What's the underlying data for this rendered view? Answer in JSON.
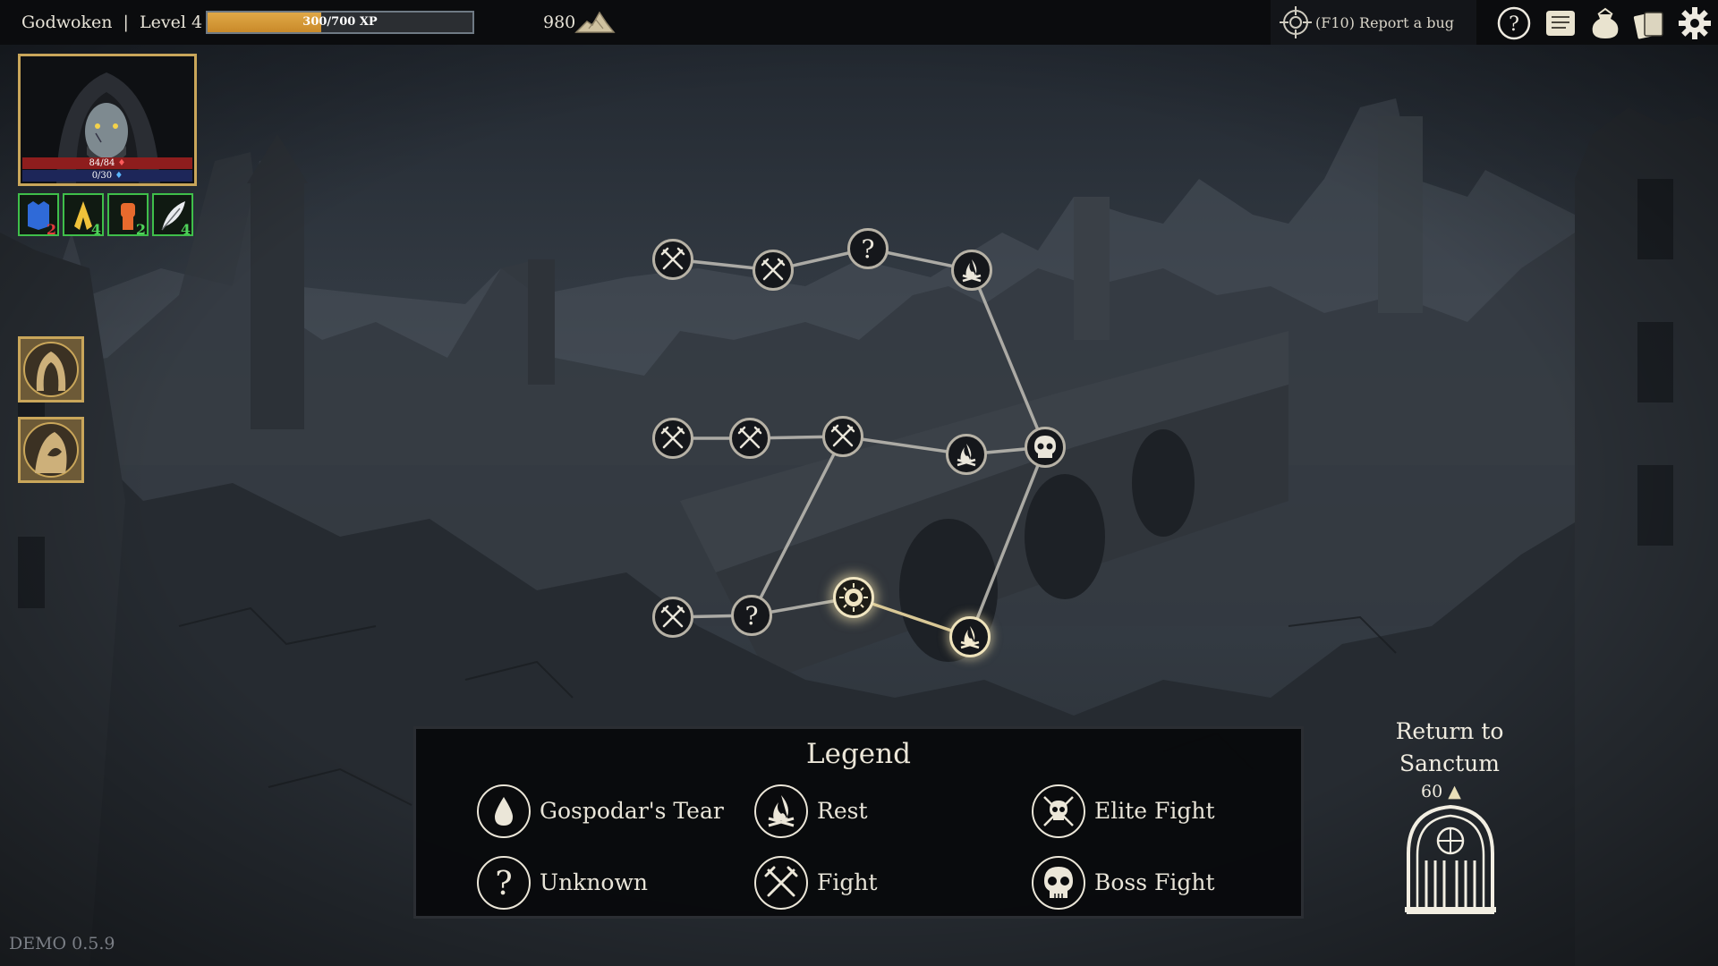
{
  "topbar": {
    "player_name": "Godwoken",
    "separator": "|",
    "level": "Level 4",
    "xp_text": "300/700 XP",
    "xp_fraction": 0.43,
    "gold": "980",
    "bug_report": "(F10) Report a bug",
    "icons": [
      "help-icon",
      "scroll-icon",
      "pouch-icon",
      "cards-icon",
      "gear-icon"
    ]
  },
  "character": {
    "hp": "84/84",
    "mana": "0/30",
    "buffs": [
      {
        "icon": "armor-icon",
        "count": "2",
        "color": "#e23b3b"
      },
      {
        "icon": "prayer-icon",
        "count": "4",
        "color": "#4fd15a"
      },
      {
        "icon": "fist-icon",
        "count": "2",
        "color": "#4fd15a"
      },
      {
        "icon": "feather-icon",
        "count": "4",
        "color": "#4fd15a"
      }
    ],
    "companions": [
      "hooded-companion-1",
      "hooded-companion-2"
    ]
  },
  "map": {
    "nodes": [
      {
        "id": "n1",
        "type": "fight"
      },
      {
        "id": "n2",
        "type": "fight"
      },
      {
        "id": "n3",
        "type": "unknown"
      },
      {
        "id": "n4",
        "type": "rest"
      },
      {
        "id": "n5",
        "type": "fight"
      },
      {
        "id": "n6",
        "type": "fight"
      },
      {
        "id": "n7",
        "type": "fight"
      },
      {
        "id": "n8",
        "type": "rest"
      },
      {
        "id": "n9",
        "type": "boss"
      },
      {
        "id": "n10",
        "type": "fight"
      },
      {
        "id": "n11",
        "type": "unknown"
      },
      {
        "id": "n12",
        "type": "current"
      },
      {
        "id": "n13",
        "type": "rest",
        "state": "available"
      }
    ]
  },
  "legend": {
    "title": "Legend",
    "items": [
      {
        "icon": "tear",
        "label": "Gospodar's Tear"
      },
      {
        "icon": "rest",
        "label": "Rest"
      },
      {
        "icon": "elite",
        "label": "Elite Fight"
      },
      {
        "icon": "unknown",
        "label": "Unknown"
      },
      {
        "icon": "fight",
        "label": "Fight"
      },
      {
        "icon": "boss",
        "label": "Boss Fight"
      }
    ]
  },
  "sanctum": {
    "title": "Return to Sanctum",
    "cost": "60"
  },
  "version": "DEMO 0.5.9"
}
